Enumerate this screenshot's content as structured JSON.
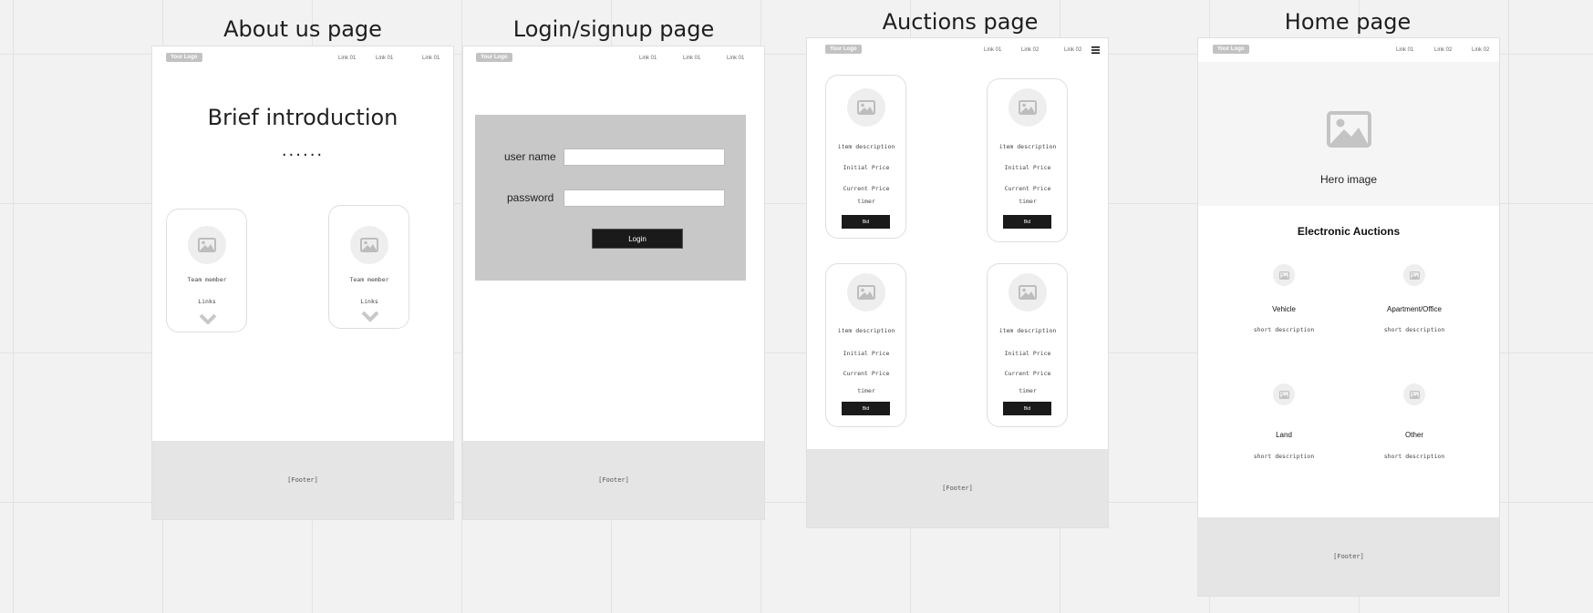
{
  "frames": {
    "about": {
      "title": "About us page",
      "logo": "Your Logo",
      "links": [
        "Link 01",
        "Link 01",
        "Link 01"
      ],
      "heading": "Brief introduction",
      "dots": "......",
      "members": [
        {
          "name": "Team member",
          "links": "Links"
        },
        {
          "name": "Team member",
          "links": "Links"
        }
      ],
      "footer": "[Footer]"
    },
    "login": {
      "title": "Login/signup page",
      "logo": "Your Logo",
      "links": [
        "Link 01",
        "Link 01",
        "Link 01"
      ],
      "username_label": "user name",
      "username_value": "",
      "password_label": "password",
      "password_value": "",
      "login_button": "Login",
      "footer": "[Footer]"
    },
    "auctions": {
      "title": "Auctions page",
      "logo": "Your Logo",
      "links": [
        "Link 01",
        "Link 02",
        "Link 02"
      ],
      "menu_icon": "hamburger-icon",
      "items": [
        {
          "description": "item description",
          "initial": "Initial Price",
          "current": "Current Price",
          "timer": "timer",
          "bid": "Bid"
        },
        {
          "description": "item description",
          "initial": "Initial Price",
          "current": "Current Price",
          "timer": "timer",
          "bid": "Bid"
        },
        {
          "description": "item description",
          "initial": "Initial Price",
          "current": "Current Price",
          "timer": "timer",
          "bid": "Bid"
        },
        {
          "description": "item description",
          "initial": "Initial Price",
          "current": "Current Price",
          "timer": "timer",
          "bid": "Bid"
        }
      ],
      "footer": "[Footer]"
    },
    "home": {
      "title": "Home  page",
      "logo": "Your Logo",
      "links": [
        "Link 01",
        "Link 02",
        "Link 02"
      ],
      "hero_label": "Hero image",
      "section_title": "Electronic Auctions",
      "categories": [
        {
          "name": "Vehicle",
          "desc": "short description"
        },
        {
          "name": "Apartment/Office",
          "desc": "short description"
        },
        {
          "name": "Land",
          "desc": "short description"
        },
        {
          "name": "Other",
          "desc": "short description"
        }
      ],
      "footer": "[Footer]"
    }
  },
  "colors": {
    "canvas": "#f2f2f2",
    "frame": "#ffffff",
    "footer": "#e5e5e5",
    "login_panel": "#c8c8c8",
    "dark_button": "#1a1a1a"
  }
}
